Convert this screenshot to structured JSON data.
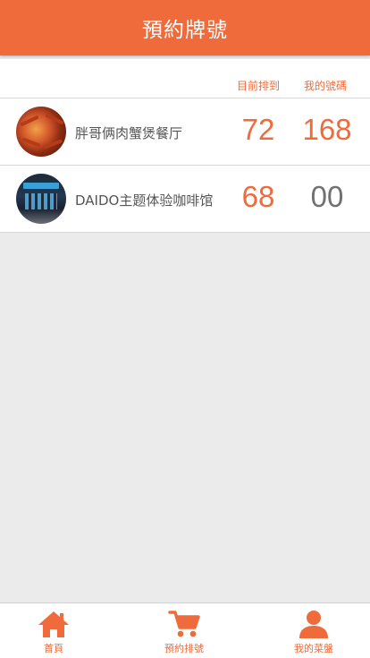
{
  "header": {
    "title": "預約牌號"
  },
  "columns": {
    "current": "目前排到",
    "mine": "我的號碼"
  },
  "restaurants": [
    {
      "name": "胖哥俩肉蟹煲餐厅",
      "current": "72",
      "mine": "168",
      "mine_color": "orange"
    },
    {
      "name": "DAIDO主题体验咖啡馆",
      "current": "68",
      "mine": "00",
      "mine_color": "gray"
    }
  ],
  "tabs": [
    {
      "label": "首頁",
      "icon": "home-icon"
    },
    {
      "label": "預約排號",
      "icon": "cart-icon"
    },
    {
      "label": "我的菜盤",
      "icon": "user-icon"
    }
  ],
  "colors": {
    "accent": "#ef6b3b",
    "background": "#ebebeb",
    "muted": "#707070"
  }
}
